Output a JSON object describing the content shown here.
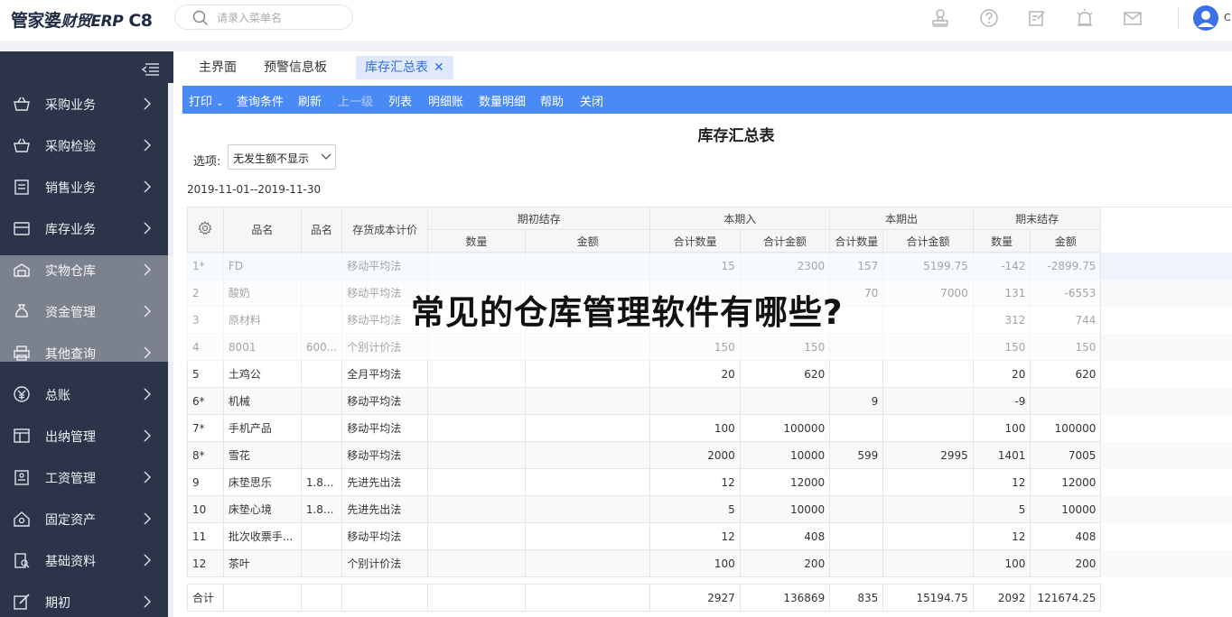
{
  "logo": {
    "brand": "管家婆",
    "product": "财贸ERP",
    "version": "C8"
  },
  "search": {
    "placeholder": "请录入菜单名"
  },
  "user": {
    "name": "C"
  },
  "sidebar": {
    "items": [
      {
        "label": "采购业务",
        "icon": "basket-icon"
      },
      {
        "label": "采购检验",
        "icon": "basket-check-icon"
      },
      {
        "label": "销售业务",
        "icon": "clipboard-icon"
      },
      {
        "label": "库存业务",
        "icon": "box-icon"
      },
      {
        "label": "实物仓库",
        "icon": "warehouse-icon"
      },
      {
        "label": "资金管理",
        "icon": "money-bag-icon"
      },
      {
        "label": "其他查询",
        "icon": "printer-icon"
      },
      {
        "label": "总账",
        "icon": "yen-icon"
      },
      {
        "label": "出纳管理",
        "icon": "layout-icon"
      },
      {
        "label": "工资管理",
        "icon": "id-card-icon"
      },
      {
        "label": "固定资产",
        "icon": "house-icon"
      },
      {
        "label": "基础资料",
        "icon": "document-search-icon"
      },
      {
        "label": "期初",
        "icon": "edit-icon"
      }
    ]
  },
  "tabs": [
    {
      "label": "主界面"
    },
    {
      "label": "预警信息板"
    },
    {
      "label": "库存汇总表",
      "active": true
    }
  ],
  "toolbar": {
    "print": "打印",
    "query": "查询条件",
    "refresh": "刷新",
    "up": "上一级",
    "list": "列表",
    "detail": "明细账",
    "qty_detail": "数量明细",
    "help": "帮助",
    "close": "关闭"
  },
  "report": {
    "title": "库存汇总表",
    "option_label": "选项:",
    "option_value": "无发生额不显示",
    "date_range": "2019-11-01--2019-11-30"
  },
  "table": {
    "headers": {
      "name": "品名",
      "spec": "品名",
      "cost_method": "存货成本计价",
      "opening": "期初结存",
      "inbound": "本期入",
      "outbound": "本期出",
      "closing": "期末结存",
      "qty": "数量",
      "amount": "金额",
      "total_qty": "合计数量",
      "total_amount": "合计金额"
    },
    "rows": [
      {
        "idx": "1*",
        "name": "FD",
        "spec": "",
        "method": "移动平均法",
        "oq": "",
        "oa": "",
        "iq": "15",
        "ia": "2300",
        "xq": "157",
        "xa": "5199.75",
        "cq": "-142",
        "ca": "-2899.75"
      },
      {
        "idx": "2",
        "name": "酸奶",
        "spec": "",
        "method": "移动平均法",
        "oq": "",
        "oa": "",
        "iq": "",
        "ia": "",
        "xq": "70",
        "xa": "7000",
        "cq": "131",
        "ca": "-6553"
      },
      {
        "idx": "3",
        "name": "原材料",
        "spec": "",
        "method": "移动平均法",
        "oq": "",
        "oa": "",
        "iq": "",
        "ia": "",
        "xq": "",
        "xa": "",
        "cq": "312",
        "ca": "744"
      },
      {
        "idx": "4",
        "name": "8001",
        "spec": "600...",
        "method": "个别计价法",
        "oq": "",
        "oa": "",
        "iq": "150",
        "ia": "150",
        "xq": "",
        "xa": "",
        "cq": "150",
        "ca": "150"
      },
      {
        "idx": "5",
        "name": "土鸡公",
        "spec": "",
        "method": "全月平均法",
        "oq": "",
        "oa": "",
        "iq": "20",
        "ia": "620",
        "xq": "",
        "xa": "",
        "cq": "20",
        "ca": "620"
      },
      {
        "idx": "6*",
        "name": "机械",
        "spec": "",
        "method": "移动平均法",
        "oq": "",
        "oa": "",
        "iq": "",
        "ia": "",
        "xq": "9",
        "xa": "",
        "cq": "-9",
        "ca": ""
      },
      {
        "idx": "7*",
        "name": "手机产品",
        "spec": "",
        "method": "移动平均法",
        "oq": "",
        "oa": "",
        "iq": "100",
        "ia": "100000",
        "xq": "",
        "xa": "",
        "cq": "100",
        "ca": "100000"
      },
      {
        "idx": "8*",
        "name": "雪花",
        "spec": "",
        "method": "移动平均法",
        "oq": "",
        "oa": "",
        "iq": "2000",
        "ia": "10000",
        "xq": "599",
        "xa": "2995",
        "cq": "1401",
        "ca": "7005"
      },
      {
        "idx": "9",
        "name": "床垫思乐",
        "spec": "1.8...",
        "method": "先进先出法",
        "oq": "",
        "oa": "",
        "iq": "12",
        "ia": "12000",
        "xq": "",
        "xa": "",
        "cq": "12",
        "ca": "12000"
      },
      {
        "idx": "10",
        "name": "床垫心境",
        "spec": "1.8...",
        "method": "先进先出法",
        "oq": "",
        "oa": "",
        "iq": "5",
        "ia": "10000",
        "xq": "",
        "xa": "",
        "cq": "5",
        "ca": "10000"
      },
      {
        "idx": "11",
        "name": "批次收票手...",
        "spec": "",
        "method": "移动平均法",
        "oq": "",
        "oa": "",
        "iq": "12",
        "ia": "408",
        "xq": "",
        "xa": "",
        "cq": "12",
        "ca": "408"
      },
      {
        "idx": "12",
        "name": "茶叶",
        "spec": "",
        "method": "个别计价法",
        "oq": "",
        "oa": "",
        "iq": "100",
        "ia": "200",
        "xq": "",
        "xa": "",
        "cq": "100",
        "ca": "200"
      }
    ],
    "total": {
      "label": "合计",
      "iq": "2927",
      "ia": "136869",
      "xq": "835",
      "xa": "15194.75",
      "cq": "2092",
      "ca": "121674.25"
    }
  },
  "watermark": "常见的仓库管理软件有哪些?"
}
